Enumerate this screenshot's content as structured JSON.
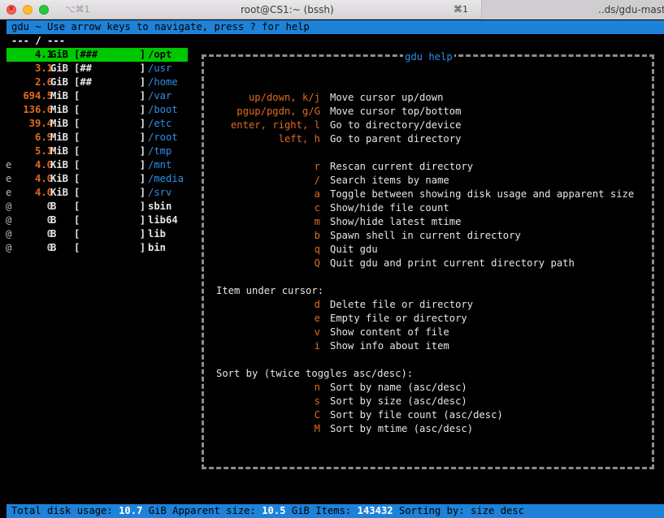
{
  "window": {
    "shortcut": "⌥⌘1",
    "title": "root@CS1:~ (bssh)",
    "tab_shortcut": "⌘1",
    "tab2_title": "..ds/gdu-maste"
  },
  "header": {
    "text": "gdu ~ Use arrow keys to navigate, press ? for help",
    "path": "--- / ---"
  },
  "files": [
    {
      "flag": "",
      "size": "4.1",
      "unit": "GiB",
      "bar": "[###       ]",
      "name": "/opt",
      "selected": true,
      "type": "dir"
    },
    {
      "flag": "",
      "size": "3.1",
      "unit": "GiB",
      "bar": "[##        ]",
      "name": "/usr",
      "type": "dir"
    },
    {
      "flag": "",
      "size": "2.6",
      "unit": "GiB",
      "bar": "[##        ]",
      "name": "/home",
      "type": "dir"
    },
    {
      "flag": "",
      "size": "694.5",
      "unit": "MiB",
      "bar": "[          ]",
      "name": "/var",
      "type": "dir"
    },
    {
      "flag": "",
      "size": "136.6",
      "unit": "MiB",
      "bar": "[          ]",
      "name": "/boot",
      "type": "dir"
    },
    {
      "flag": "",
      "size": "39.4",
      "unit": "MiB",
      "bar": "[          ]",
      "name": "/etc",
      "type": "dir"
    },
    {
      "flag": "",
      "size": "6.9",
      "unit": "MiB",
      "bar": "[          ]",
      "name": "/root",
      "type": "dir"
    },
    {
      "flag": "",
      "size": "5.1",
      "unit": "MiB",
      "bar": "[          ]",
      "name": "/tmp",
      "type": "dir"
    },
    {
      "flag": "e",
      "size": "4.0",
      "unit": "KiB",
      "bar": "[          ]",
      "name": "/mnt",
      "type": "dir"
    },
    {
      "flag": "e",
      "size": "4.0",
      "unit": "KiB",
      "bar": "[          ]",
      "name": "/media",
      "type": "dir"
    },
    {
      "flag": "e",
      "size": "4.0",
      "unit": "KiB",
      "bar": "[          ]",
      "name": "/srv",
      "type": "dir"
    },
    {
      "flag": "@",
      "size": "0",
      "unit": "B",
      "bar": "[          ]",
      "name": "sbin",
      "type": "file"
    },
    {
      "flag": "@",
      "size": "0",
      "unit": "B",
      "bar": "[          ]",
      "name": "lib64",
      "type": "file"
    },
    {
      "flag": "@",
      "size": "0",
      "unit": "B",
      "bar": "[          ]",
      "name": "lib",
      "type": "file"
    },
    {
      "flag": "@",
      "size": "0",
      "unit": "B",
      "bar": "[          ]",
      "name": "bin",
      "type": "file"
    }
  ],
  "help": {
    "title": "gdu help",
    "navigation": [
      {
        "key": "up/down, k/j",
        "desc": "Move cursor up/down"
      },
      {
        "key": "pgup/pgdn, g/G",
        "desc": "Move cursor top/bottom"
      },
      {
        "key": "enter, right, l",
        "desc": "Go to directory/device"
      },
      {
        "key": "left, h",
        "desc": "Go to parent directory"
      }
    ],
    "actions": [
      {
        "key": "r",
        "desc": "Rescan current directory"
      },
      {
        "key": "/",
        "desc": "Search items by name"
      },
      {
        "key": "a",
        "desc": "Toggle between showing disk usage and apparent size"
      },
      {
        "key": "c",
        "desc": "Show/hide file count"
      },
      {
        "key": "m",
        "desc": "Show/hide latest mtime"
      },
      {
        "key": "b",
        "desc": "Spawn shell in current directory"
      },
      {
        "key": "q",
        "desc": "Quit gdu"
      },
      {
        "key": "Q",
        "desc": "Quit gdu and print current directory path"
      }
    ],
    "item_heading": "Item under cursor:",
    "item": [
      {
        "key": "d",
        "desc": "Delete file or directory"
      },
      {
        "key": "e",
        "desc": "Empty file or directory"
      },
      {
        "key": "v",
        "desc": "Show content of file"
      },
      {
        "key": "i",
        "desc": "Show info about item"
      }
    ],
    "sort_heading": "Sort by (twice toggles asc/desc):",
    "sort": [
      {
        "key": "n",
        "desc": "Sort by name (asc/desc)"
      },
      {
        "key": "s",
        "desc": "Sort by size (asc/desc)"
      },
      {
        "key": "C",
        "desc": "Sort by file count (asc/desc)"
      },
      {
        "key": "M",
        "desc": "Sort by mtime (asc/desc)"
      }
    ]
  },
  "footer": {
    "total_label": "Total disk usage: ",
    "total_value": "10.7",
    "total_unit": " GiB ",
    "apparent_label": "Apparent size: ",
    "apparent_value": "10.5",
    "apparent_unit": " GiB ",
    "items_label": "Items: ",
    "items_value": "143432",
    "sorting_label": " Sorting by: ",
    "sorting_value": "size desc"
  }
}
